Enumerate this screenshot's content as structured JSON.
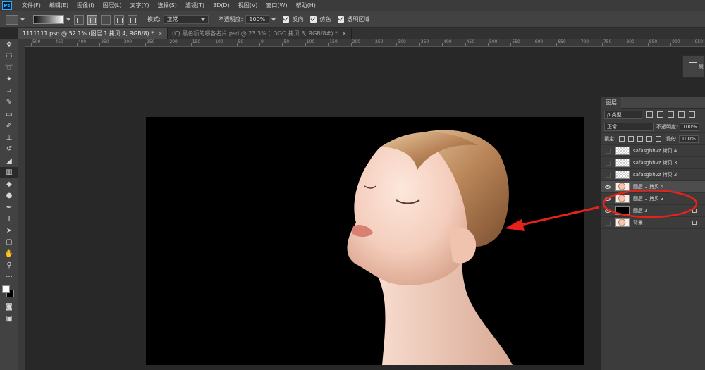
{
  "app": {
    "logo": "Ps"
  },
  "menu": [
    "文件(F)",
    "编辑(E)",
    "图像(I)",
    "图层(L)",
    "文字(Y)",
    "选择(S)",
    "滤镜(T)",
    "3D(D)",
    "视图(V)",
    "窗口(W)",
    "帮助(H)"
  ],
  "options": {
    "mode_label": "模式:",
    "mode_value": "正常",
    "opacity_label": "不透明度:",
    "opacity_value": "100%",
    "reverse_label": "反向",
    "dither_label": "仿色",
    "transparency_label": "透明区域"
  },
  "tabs": [
    {
      "title": "1111111.psd @ 52.1% (图层 1 拷贝 4, RGB/8) *",
      "close": "×"
    },
    {
      "title": "(C) 黑色项的哪各名片.psd @ 23.3% (LOGO 拷贝 3, RGB/8#) *",
      "close": "×"
    }
  ],
  "ruler": [
    "500",
    "450",
    "400",
    "350",
    "300",
    "250",
    "200",
    "150",
    "100",
    "50",
    "0",
    "50",
    "100",
    "150",
    "200",
    "250",
    "300",
    "350",
    "400",
    "450",
    "500",
    "550",
    "600",
    "650",
    "700",
    "750",
    "800",
    "850",
    "900",
    "950"
  ],
  "mini_panel": {
    "label": "属"
  },
  "layers_panel": {
    "tab": "图层",
    "filter_value": "ρ 类型",
    "blend_mode": "正常",
    "opacity_label": "不透明度:",
    "opacity_value": "100%",
    "lock_label": "锁定:",
    "fill_label": "填充:",
    "fill_value": "100%",
    "layers": [
      {
        "name": "safasgbhvz 拷贝 4",
        "visible": false,
        "thumb": "checker",
        "selected": false
      },
      {
        "name": "safasgbhvz 拷贝 3",
        "visible": false,
        "thumb": "checker",
        "selected": false
      },
      {
        "name": "safasgbhvz 拷贝 2",
        "visible": false,
        "thumb": "checker",
        "selected": false
      },
      {
        "name": "图层 1 拷贝 4",
        "visible": true,
        "thumb": "portrait",
        "selected": true
      },
      {
        "name": "图层 1 拷贝 3",
        "visible": true,
        "thumb": "portrait",
        "selected": false
      },
      {
        "name": "图层 3",
        "visible": true,
        "thumb": "black",
        "selected": false,
        "locked": true
      },
      {
        "name": "背景",
        "visible": false,
        "thumb": "portrait",
        "selected": false,
        "locked": true
      }
    ]
  },
  "colors": {
    "foreground": "#ffffff",
    "background": "#000000",
    "annotation": "#e8221b",
    "accent": "#31a8ff"
  }
}
